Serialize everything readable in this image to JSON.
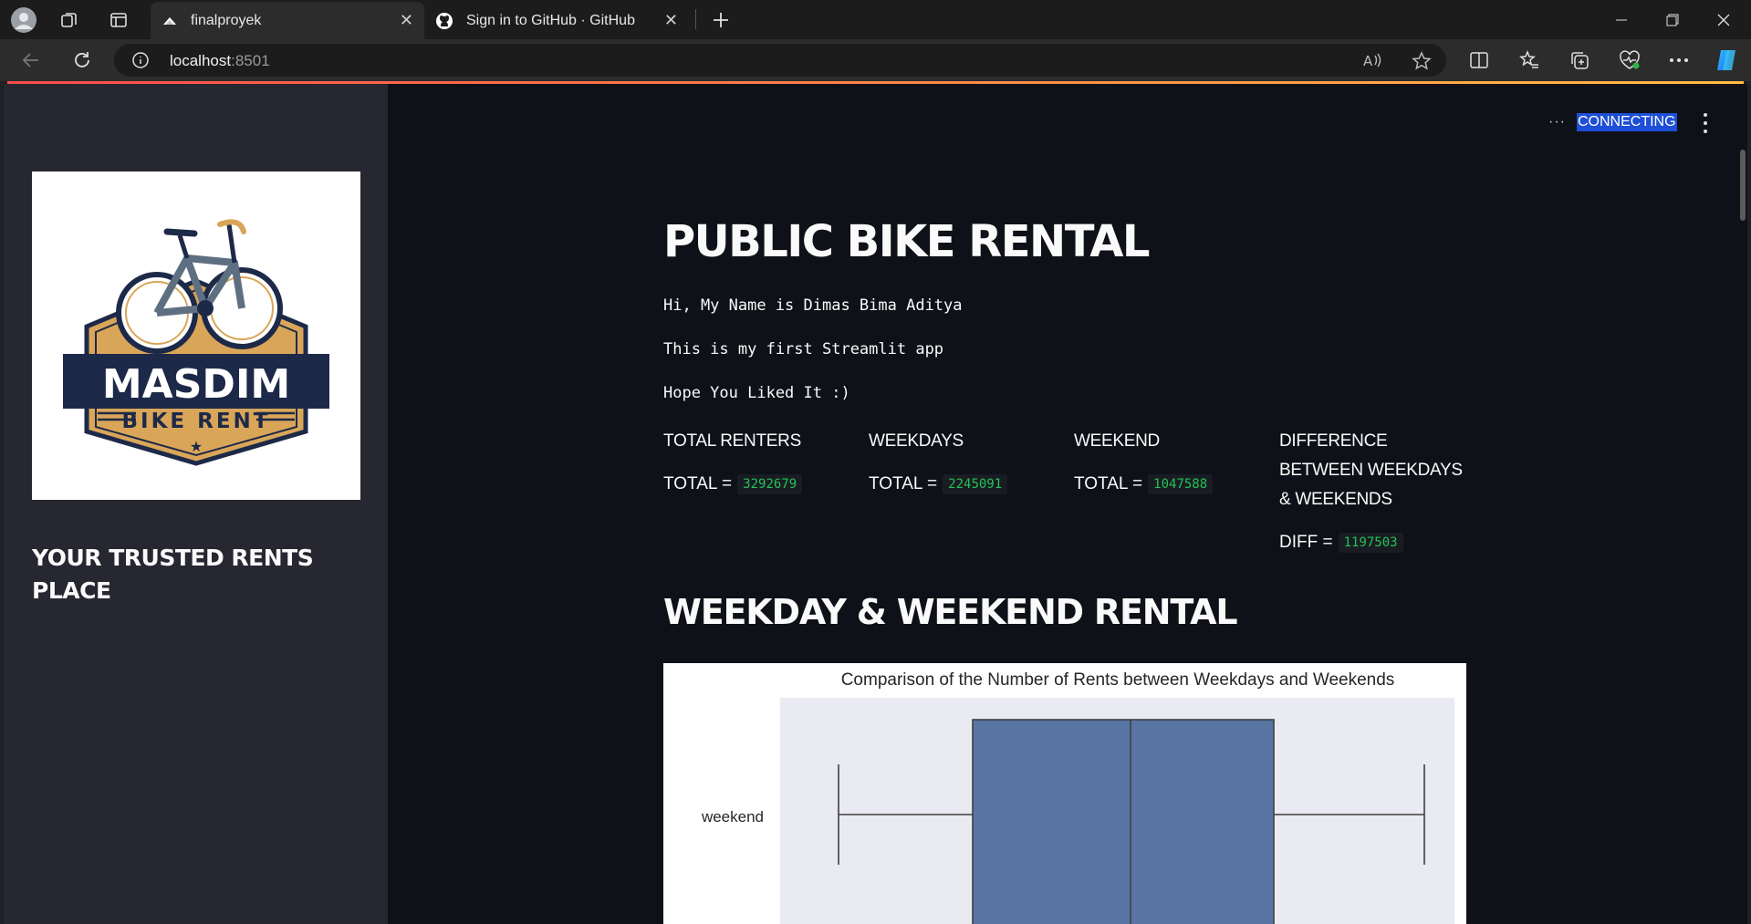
{
  "browser": {
    "tabs": [
      {
        "title": "finalproyek",
        "active": true
      },
      {
        "title": "Sign in to GitHub · GitHub",
        "active": false
      }
    ],
    "address": {
      "host": "localhost",
      "port": ":8501"
    }
  },
  "status": {
    "dots": "···",
    "text": "CONNECTING"
  },
  "sidebar": {
    "logo": {
      "line1": "MASDIM",
      "line2": "BIKE RENT"
    },
    "title": "YOUR TRUSTED RENTS PLACE"
  },
  "main": {
    "title": "PUBLIC BIKE RENTAL",
    "lines": [
      "Hi, My Name is Dimas Bima Aditya",
      "This is my first Streamlit app",
      "Hope You Liked It :)"
    ],
    "metrics": [
      {
        "label": "TOTAL RENTERS",
        "prefix": "TOTAL =",
        "value": "3292679"
      },
      {
        "label": "WEEKDAYS",
        "prefix": "TOTAL =",
        "value": "2245091"
      },
      {
        "label": "WEEKEND",
        "prefix": "TOTAL =",
        "value": "1047588"
      },
      {
        "label": "DIFFERENCE BETWEEN WEEKDAYS & WEEKENDS",
        "prefix": "DIFF =",
        "value": "1197503"
      }
    ],
    "section_title": "WEEKDAY & WEEKEND RENTAL"
  },
  "chart_data": {
    "type": "box",
    "title": "Comparison of the Number of Rents between Weekdays and Weekends",
    "categories": [
      "weekend"
    ],
    "orientation": "horizontal",
    "colors": {
      "box": "#5875a4",
      "plot_bg": "#eaeaf2"
    }
  }
}
